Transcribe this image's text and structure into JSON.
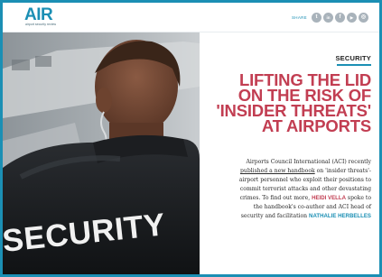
{
  "header": {
    "logo_text": "AIR",
    "logo_subtitle": "airport security review",
    "share_label": "SHARE",
    "share_icons": [
      {
        "name": "twitter-icon",
        "glyph": "t"
      },
      {
        "name": "linkedin-icon",
        "glyph": "in"
      },
      {
        "name": "facebook-icon",
        "glyph": "f"
      },
      {
        "name": "youtube-icon",
        "glyph": "▶"
      },
      {
        "name": "instagram-icon",
        "glyph": "◎"
      }
    ]
  },
  "photo": {
    "jacket_text": "SECURITY"
  },
  "article": {
    "section": "SECURITY",
    "headline_lines": [
      "LIFTING THE LID",
      "ON THE RISK OF",
      "'INSIDER THREATS'",
      "AT AIRPORTS"
    ],
    "standfirst": {
      "l1": "Airports Council International (ACI) recently",
      "l2_link": "published a new handbook",
      "l2_rest": " on 'insider threats'-",
      "l3": "airport personnel who exploit their positions to",
      "l4": "commit terrorist attacks and other devastating",
      "l5_pre": "crimes. To find out more, ",
      "l5_author": "HEIDI VELLA",
      "l5_post": " spoke to",
      "l6": "the handbook's co-author and ACI head of",
      "l7_pre": "security and facilitation ",
      "l7_name": "NATHALIE HERBELLES"
    }
  },
  "colors": {
    "brand_blue": "#1b8fb4",
    "headline_red": "#c23e52",
    "icon_grey": "#a9b3bb"
  }
}
